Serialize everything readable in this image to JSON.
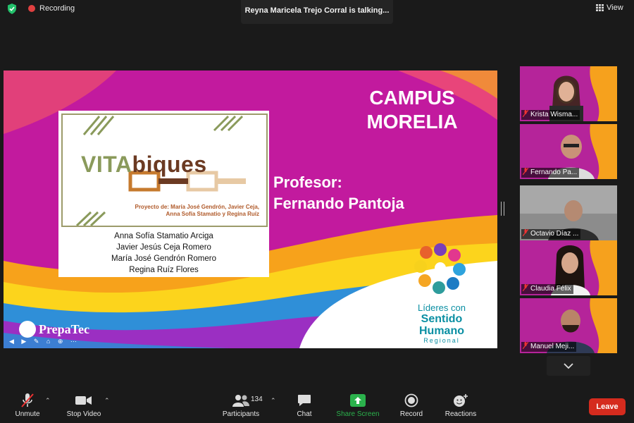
{
  "topbar": {
    "recording_label": "Recording",
    "talking_label": "Reyna Maricela Trejo Corral is talking...",
    "view_label": "View"
  },
  "slide": {
    "campus_line1": "CAMPUS",
    "campus_line2": "MORELIA",
    "profesor_label": "Profesor:",
    "profesor_name": "Fernando Pantoja",
    "logo_vita": "VITA",
    "logo_biques": "biques",
    "logo_credit_line1": "Proyecto de: María José Gendrón, Javier Ceja,",
    "logo_credit_line2": "Anna Sofía Stamatio y Regina Ruíz",
    "students": [
      "Anna Sofía Stamatio Arciga",
      "Javier Jesús Ceja Romero",
      "María José Gendrón Romero",
      "Regina Ruíz Flores"
    ],
    "prepatec": "PrepaTec",
    "lideres_line1": "Líderes con",
    "lideres_line2": "Sentido",
    "lideres_line3": "Humano",
    "lideres_line4": "Regional"
  },
  "participants": [
    {
      "name": "Krista Wisma..."
    },
    {
      "name": "Fernando Pa..."
    },
    {
      "name": "Octavio Díaz ..."
    },
    {
      "name": "Claudia Félix"
    },
    {
      "name": "Manuel Meji..."
    }
  ],
  "toolbar": {
    "unmute": "Unmute",
    "stop_video": "Stop Video",
    "participants": "Participants",
    "participants_count": "134",
    "chat": "Chat",
    "share_screen": "Share Screen",
    "record": "Record",
    "reactions": "Reactions",
    "leave": "Leave"
  },
  "colors": {
    "share_green": "#2bb24c",
    "leave_red": "#d52b1e",
    "slide_magenta": "#c21a9e"
  }
}
